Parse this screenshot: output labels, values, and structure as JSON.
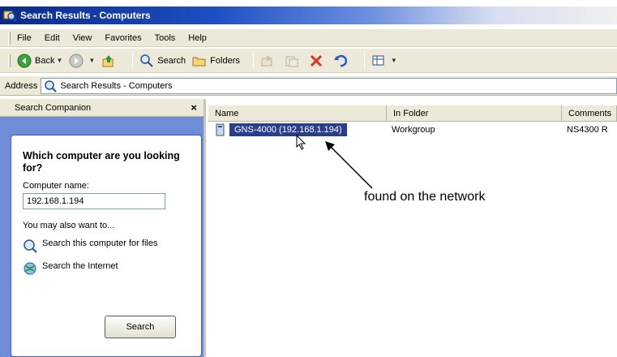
{
  "window": {
    "title": "Search Results - Computers"
  },
  "menubar": {
    "items": [
      "File",
      "Edit",
      "View",
      "Favorites",
      "Tools",
      "Help"
    ]
  },
  "toolbar": {
    "back_label": "Back",
    "search_label": "Search",
    "folders_label": "Folders"
  },
  "address": {
    "label": "Address",
    "value": "Search Results - Computers"
  },
  "search_companion": {
    "header": "Search Companion",
    "close": "×",
    "question": "Which computer are you looking for?",
    "field_label": "Computer name:",
    "field_value": "192.168.1.194",
    "also_label": "You may also want to...",
    "link_computer": "Search this computer for files",
    "link_internet": "Search the Internet",
    "search_button": "Search"
  },
  "results": {
    "columns": [
      "Name",
      "In Folder",
      "Comments"
    ],
    "rows": [
      {
        "name": "GNS-4000 (192.168.1.194)",
        "folder": "Workgroup",
        "comments": "NS4300 R"
      }
    ]
  },
  "annotation": {
    "text": "found on the network"
  }
}
